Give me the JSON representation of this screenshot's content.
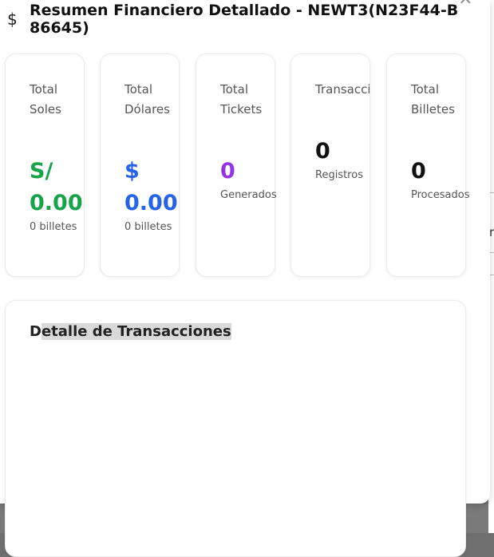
{
  "modal": {
    "title": "Resumen Financiero Detallado - NEWT3(N23F44-B86645)",
    "icon": "dollar-icon",
    "close_icon": "close-icon",
    "icon_glyph": "$",
    "close_glyph": "×"
  },
  "cards": [
    {
      "label": "Total Soles",
      "value": "S/ 0.00",
      "sub": "0 billetes",
      "color": "#16a34a"
    },
    {
      "label": "Total Dólares",
      "value": "$ 0.00",
      "sub": "0 billetes",
      "color": "#2563eb"
    },
    {
      "label": "Total Tickets",
      "value": "0",
      "sub": "Generados",
      "color": "#9333ea"
    },
    {
      "label": "Transacciones",
      "value": "0",
      "sub": "Registros",
      "color": "#111111"
    },
    {
      "label": "Total Billetes",
      "value": "0",
      "sub": "Procesados",
      "color": "#111111"
    }
  ],
  "detail": {
    "title_prefix": "D",
    "title_highlight": "etalle de Transacciones"
  },
  "background": {
    "glyph": "r"
  }
}
